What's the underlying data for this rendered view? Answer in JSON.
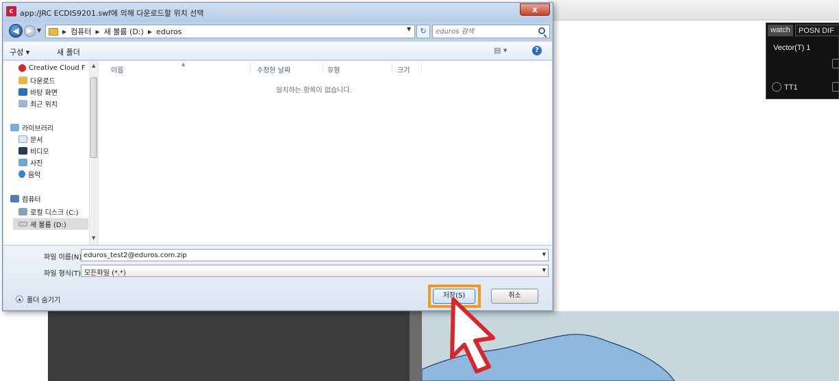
{
  "background_app": {
    "panel": {
      "tab_watch": "watch",
      "tab_posn": "POSN DIF",
      "vector": "Vector(T)  1",
      "target": "TT1"
    },
    "colors": {
      "sea": "#8fb8e0",
      "land": "#c6d8de",
      "panel_bg": "#121212"
    }
  },
  "dialog": {
    "title": "app:/JRC ECDIS9201.swf에 의해 다운로드할 위치 선택",
    "close_label": "x",
    "address": {
      "breadcrumb": [
        "컴퓨터",
        "새 볼륨 (D:)",
        "eduros"
      ],
      "search_placeholder": "eduros 검색"
    },
    "toolbar": {
      "organize": "구성 ▾",
      "new_folder": "새 폴더",
      "view": "▤ ▾",
      "help": "?"
    },
    "nav_pane": {
      "items": [
        {
          "label": "Creative Cloud F",
          "icon": "creative-cloud-icon"
        },
        {
          "label": "다운로드",
          "icon": "downloads-icon"
        },
        {
          "label": "바탕 화면",
          "icon": "desktop-icon"
        },
        {
          "label": "최근 위치",
          "icon": "recent-places-icon"
        },
        {
          "label": "라이브러리",
          "icon": "libraries-icon"
        },
        {
          "label": "문서",
          "icon": "documents-icon"
        },
        {
          "label": "비디오",
          "icon": "videos-icon"
        },
        {
          "label": "사진",
          "icon": "pictures-icon"
        },
        {
          "label": "음악",
          "icon": "music-icon"
        },
        {
          "label": "컴퓨터",
          "icon": "computer-icon"
        },
        {
          "label": "로컬 디스크 (C:)",
          "icon": "local-disk-icon"
        },
        {
          "label": "새 볼륨 (D:)",
          "icon": "volume-icon",
          "selected": true
        }
      ]
    },
    "file_list": {
      "columns": [
        "이름",
        "수정한 날짜",
        "유형",
        "크기"
      ],
      "empty_message": "일치하는 항목이 없습니다."
    },
    "form": {
      "filename_label": "파일 이름(N):",
      "filename_value": "eduros_test2@eduros.com.zip",
      "filetype_label": "파일 형식(T):",
      "filetype_value": "모든파일 (*.*)",
      "hide_folders": "폴더 숨기기",
      "save_button": "저장(S)",
      "cancel_button": "취소"
    },
    "colors": {
      "highlight": "#f29a1f",
      "pointer": "#d8262c",
      "titlebar": "#bdd2ea"
    }
  }
}
